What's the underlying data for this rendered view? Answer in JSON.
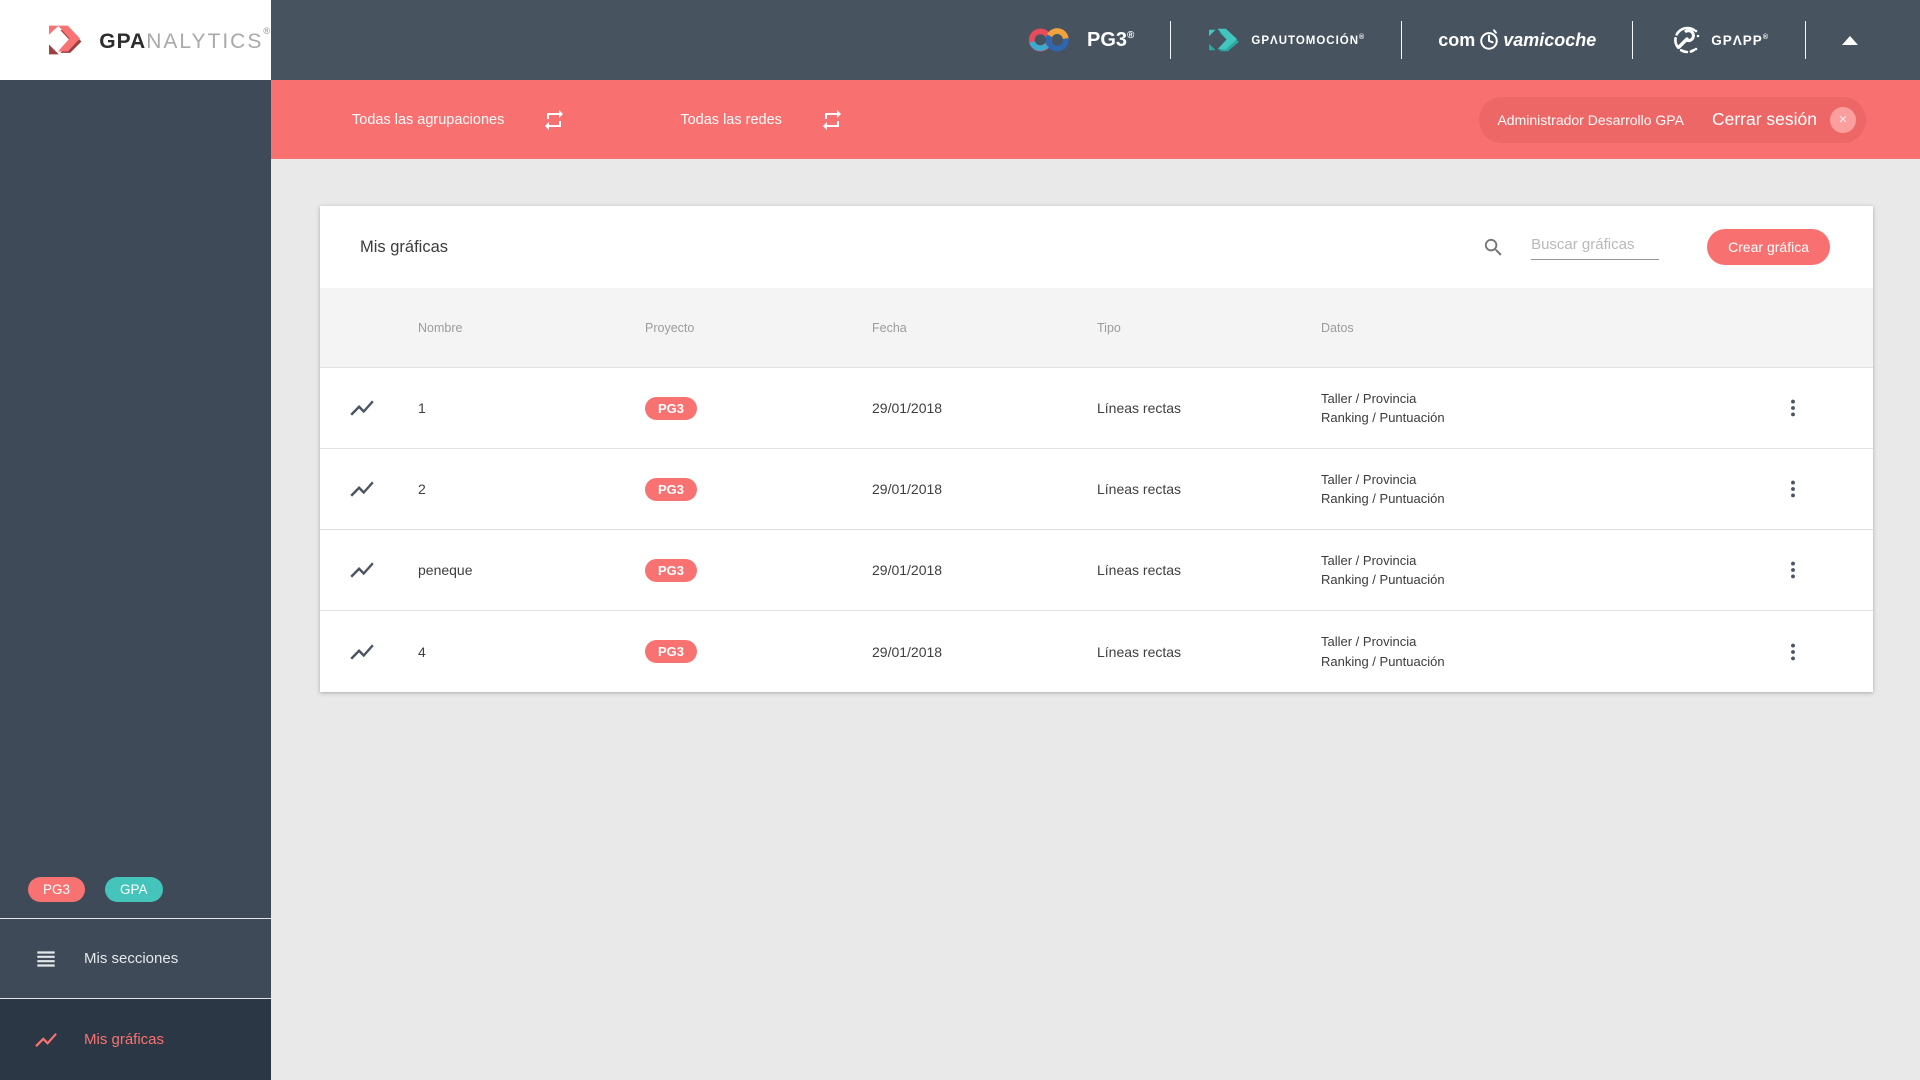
{
  "brand": {
    "sidebar_logo": {
      "bold": "GPA",
      "light": "NALYTICS",
      "reg": "®"
    },
    "topbar": {
      "pg3": "PG3",
      "pg3_reg": "®",
      "gpautomocion": "GPΛUTOMOCIÓN",
      "gpautomocion_reg": "®",
      "comprova_pre": "com",
      "comprova_post": "vamicoche",
      "gpapp": "GPΛPP",
      "gpapp_reg": "®"
    }
  },
  "filterbar": {
    "groupings_label": "Todas las agrupaciones",
    "networks_label": "Todas las redes",
    "user_name": "Administrador Desarrollo GPA",
    "logout_label": "Cerrar sesión",
    "logout_close": "×"
  },
  "card": {
    "title": "Mis gráficas",
    "search_placeholder": "Buscar gráficas",
    "create_button": "Crear gráfica"
  },
  "table": {
    "headers": {
      "name": "Nombre",
      "project": "Proyecto",
      "date": "Fecha",
      "type": "Tipo",
      "data": "Datos"
    },
    "rows": [
      {
        "name": "1",
        "project": "PG3",
        "date": "29/01/2018",
        "type": "Líneas rectas",
        "data_line1": "Taller / Provincia",
        "data_line2": "Ranking / Puntuación"
      },
      {
        "name": "2",
        "project": "PG3",
        "date": "29/01/2018",
        "type": "Líneas rectas",
        "data_line1": "Taller / Provincia",
        "data_line2": "Ranking / Puntuación"
      },
      {
        "name": "peneque",
        "project": "PG3",
        "date": "29/01/2018",
        "type": "Líneas rectas",
        "data_line1": "Taller / Provincia",
        "data_line2": "Ranking / Puntuación"
      },
      {
        "name": "4",
        "project": "PG3",
        "date": "29/01/2018",
        "type": "Líneas rectas",
        "data_line1": "Taller / Provincia",
        "data_line2": "Ranking / Puntuación"
      }
    ]
  },
  "sidebar": {
    "badges": [
      {
        "label": "PG3"
      },
      {
        "label": "GPA"
      }
    ],
    "items": [
      {
        "label": "Mis secciones"
      },
      {
        "label": "Mis gráficas",
        "active": true
      }
    ]
  },
  "icons": {
    "row_icon": "line-chart-icon",
    "filter_icon": "repeat-arrows-icon",
    "menu_icon": "kebab-menu-icon"
  },
  "colors": {
    "accent_red": "#f87070",
    "badge_red": "#f87272",
    "badge_teal": "#45c4bc",
    "topbar": "#47535f",
    "sidebar": "#3e4a57",
    "sidebar_active": "#2b3744",
    "content_bg": "#e9e9e9"
  }
}
